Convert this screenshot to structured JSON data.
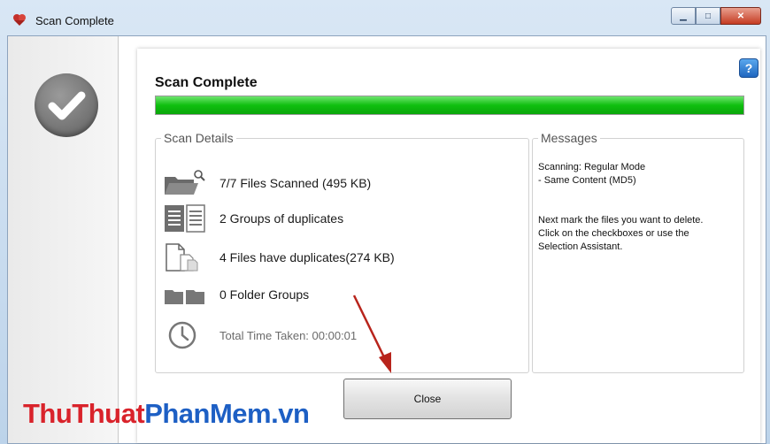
{
  "window": {
    "title": "Scan Complete"
  },
  "header": {
    "title": "Scan Complete",
    "progress_fraction": 1.0
  },
  "scan_details": {
    "legend": "Scan Details",
    "rows": [
      {
        "icon": "folder-search-icon",
        "label": "7/7 Files Scanned (495 KB)"
      },
      {
        "icon": "duplicate-groups-icon",
        "label": "2 Groups of duplicates"
      },
      {
        "icon": "duplicate-files-icon",
        "label": "4 Files have duplicates(274 KB)"
      },
      {
        "icon": "folder-groups-icon",
        "label": "0 Folder Groups"
      },
      {
        "icon": "clock-icon",
        "label": "Total Time Taken: 00:00:01"
      }
    ]
  },
  "messages": {
    "legend": "Messages",
    "lines": [
      "Scanning: Regular Mode",
      "- Same Content (MD5)",
      "",
      "",
      "Next mark the files you want to delete.",
      "Click on the checkboxes or use the",
      "Selection Assistant."
    ]
  },
  "close_button": {
    "label": "Close"
  },
  "watermark": {
    "part1": "ThuThuat",
    "part2": "PhanMem.vn"
  },
  "colors": {
    "progress": "#0fbf0f",
    "arrow": "#b8241c",
    "watermark_red": "#d9232b",
    "watermark_blue": "#1d5fc4"
  }
}
